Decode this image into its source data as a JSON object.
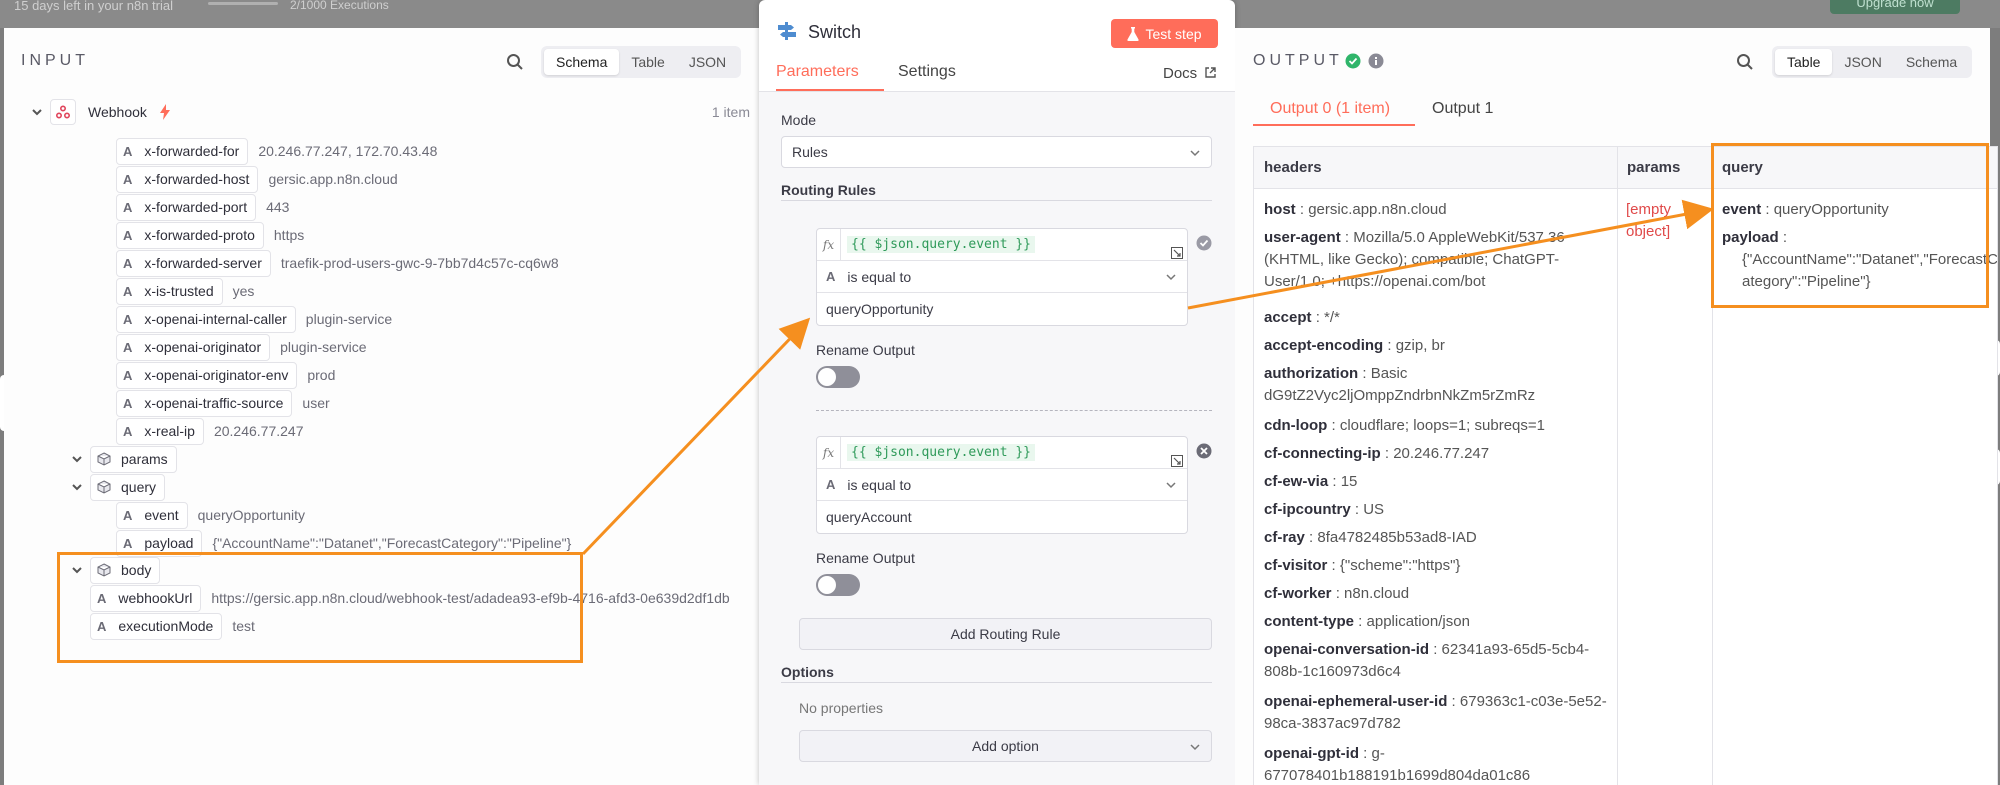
{
  "topbar": {
    "trial_text": "15 days left in your n8n trial",
    "executions_text": "2/1000 Executions",
    "upgrade_label": "Upgrade now"
  },
  "input": {
    "title": "INPUT",
    "view_modes": [
      "Schema",
      "Table",
      "JSON"
    ],
    "active_view": "Schema",
    "node_name": "Webhook",
    "item_count": "1 item",
    "header_fields": [
      {
        "key": "x-forwarded-for",
        "value": "20.246.77.247, 172.70.43.48"
      },
      {
        "key": "x-forwarded-host",
        "value": "gersic.app.n8n.cloud"
      },
      {
        "key": "x-forwarded-port",
        "value": "443"
      },
      {
        "key": "x-forwarded-proto",
        "value": "https"
      },
      {
        "key": "x-forwarded-server",
        "value": "traefik-prod-users-gwc-9-7bb7d4c57c-cq6w8"
      },
      {
        "key": "x-is-trusted",
        "value": "yes"
      },
      {
        "key": "x-openai-internal-caller",
        "value": "plugin-service"
      },
      {
        "key": "x-openai-originator",
        "value": "plugin-service"
      },
      {
        "key": "x-openai-originator-env",
        "value": "prod"
      },
      {
        "key": "x-openai-traffic-source",
        "value": "user"
      },
      {
        "key": "x-real-ip",
        "value": "20.246.77.247"
      }
    ],
    "params_label": "params",
    "query_label": "query",
    "query_fields": [
      {
        "key": "event",
        "value": "queryOpportunity"
      },
      {
        "key": "payload",
        "value": "{\"AccountName\":\"Datanet\",\"ForecastCategory\":\"Pipeline\"}"
      }
    ],
    "body_label": "body",
    "root_fields": [
      {
        "key": "webhookUrl",
        "value": "https://gersic.app.n8n.cloud/webhook-test/adadea93-ef9b-4716-afd3-0e639d2df1db"
      },
      {
        "key": "executionMode",
        "value": "test"
      }
    ]
  },
  "node": {
    "title": "Switch",
    "test_step_label": "Test step",
    "tabs": [
      "Parameters",
      "Settings"
    ],
    "active_tab": "Parameters",
    "docs_label": "Docs",
    "mode_label": "Mode",
    "mode_value": "Rules",
    "routing_rules_label": "Routing Rules",
    "rules": [
      {
        "expression": "{{ $json.query.event }}",
        "operator": "is equal to",
        "value": "queryOpportunity",
        "rename_label": "Rename Output"
      },
      {
        "expression": "{{ $json.query.event }}",
        "operator": "is equal to",
        "value": "queryAccount",
        "rename_label": "Rename Output"
      }
    ],
    "add_rule_label": "Add Routing Rule",
    "options_label": "Options",
    "no_properties": "No properties",
    "add_option_label": "Add option"
  },
  "output": {
    "title": "OUTPUT",
    "view_modes": [
      "Table",
      "JSON",
      "Schema"
    ],
    "active_view": "Table",
    "tabs": [
      "Output 0 (1 item)",
      "Output 1"
    ],
    "active_tab": "Output 0 (1 item)",
    "columns": [
      "headers",
      "params",
      "query"
    ],
    "headers": [
      {
        "key": "host",
        "value": "gersic.app.n8n.cloud"
      },
      {
        "key": "user-agent",
        "value": "Mozilla/5.0 AppleWebKit/537.36 (KHTML, like Gecko); compatible; ChatGPT-User/1.0; +https://openai.com/bot"
      },
      {
        "key": "accept",
        "value": "*/*"
      },
      {
        "key": "accept-encoding",
        "value": "gzip, br"
      },
      {
        "key": "authorization",
        "value": "Basic dG9tZ2Vyc2ljOmppZndrbnNkZm5rZmRz"
      },
      {
        "key": "cdn-loop",
        "value": "cloudflare; loops=1; subreqs=1"
      },
      {
        "key": "cf-connecting-ip",
        "value": "20.246.77.247"
      },
      {
        "key": "cf-ew-via",
        "value": "15"
      },
      {
        "key": "cf-ipcountry",
        "value": "US"
      },
      {
        "key": "cf-ray",
        "value": "8fa4782485b53ad8-IAD"
      },
      {
        "key": "cf-visitor",
        "value": "{\"scheme\":\"https\"}"
      },
      {
        "key": "cf-worker",
        "value": "n8n.cloud"
      },
      {
        "key": "content-type",
        "value": "application/json"
      },
      {
        "key": "openai-conversation-id",
        "value": "62341a93-65d5-5cb4-808b-1c160973d6c4"
      },
      {
        "key": "openai-ephemeral-user-id",
        "value": "679363c1-c03e-5e52-98ca-3837ac97d782"
      },
      {
        "key": "openai-gpt-id",
        "value": "g-677078401b188191b1699d804da01c86"
      }
    ],
    "params_value": "[empty object]",
    "query_event_key": "event",
    "query_event_value": "queryOpportunity",
    "query_payload_key": "payload",
    "query_payload_value": "{\"AccountName\":\"Datanet\",\"ForecastCategory\":\"Pipeline\"}",
    "separator": " : "
  },
  "colors": {
    "accent": "#ff6d5a",
    "highlight": "#f58f1f",
    "success": "#2fb56a"
  }
}
